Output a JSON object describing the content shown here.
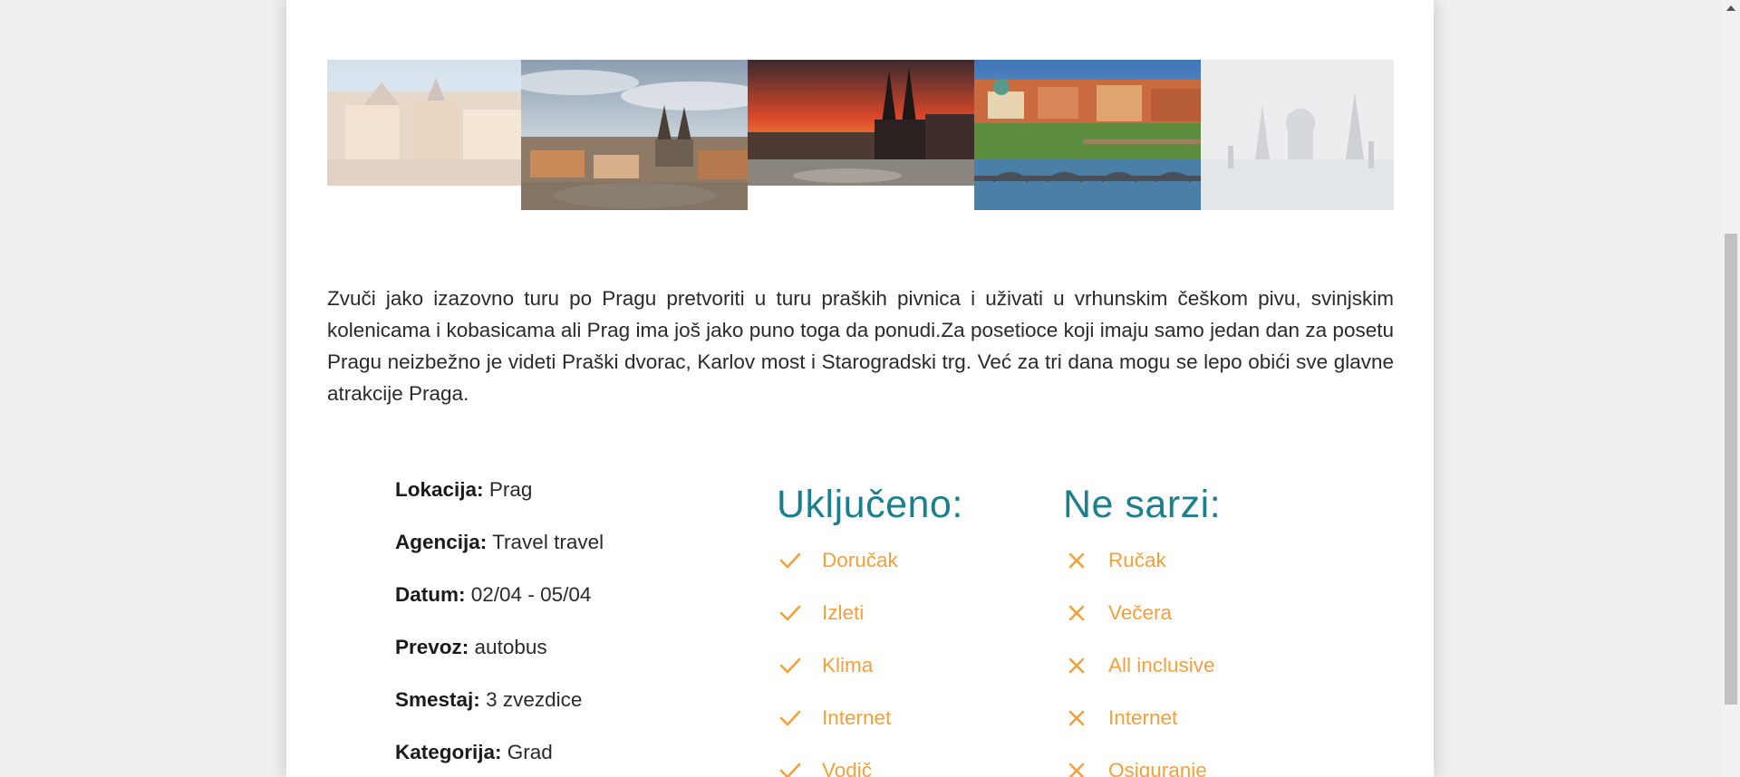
{
  "gallery": {
    "images": [
      {
        "name": "prague-rooftops-photo"
      },
      {
        "name": "old-town-aerial-photo"
      },
      {
        "name": "tyn-church-sunset-photo"
      },
      {
        "name": "vltava-bridges-photo"
      },
      {
        "name": "charles-bridge-fog-photo"
      }
    ]
  },
  "description": "Zvuči jako izazovno turu po Pragu pretvoriti u turu praških pivnica i uživati u vrhunskim češkom pivu, svinjskim kolenicama i kobasicama ali Prag ima još jako puno toga da ponudi.Za posetioce koji imaju samo jedan dan za posetu Pragu neizbežno je videti Praški dvorac, Karlov most i Starogradski trg. Već za tri dana mogu se lepo obići sve glavne atrakcije Praga.",
  "details": [
    {
      "label": "Lokacija:",
      "value": "Prag"
    },
    {
      "label": "Agencija:",
      "value": "Travel travel"
    },
    {
      "label": "Datum:",
      "value": "02/04 - 05/04"
    },
    {
      "label": "Prevoz:",
      "value": "autobus"
    },
    {
      "label": "Smestaj:",
      "value": "3 zvezdice"
    },
    {
      "label": "Kategorija:",
      "value": "Grad"
    }
  ],
  "included": {
    "title": "Uključeno:",
    "icon": "check-icon",
    "items": [
      "Doručak",
      "Izleti",
      "Klima",
      "Internet",
      "Vodič"
    ]
  },
  "excluded": {
    "title": "Ne sarzi:",
    "icon": "x-icon",
    "items": [
      "Ručak",
      "Večera",
      "All inclusive",
      "Internet",
      "Osiguranje"
    ]
  },
  "colors": {
    "accent_teal": "#1b7f8d",
    "accent_orange": "#f3a03a",
    "background": "#efefef",
    "card": "#ffffff"
  }
}
